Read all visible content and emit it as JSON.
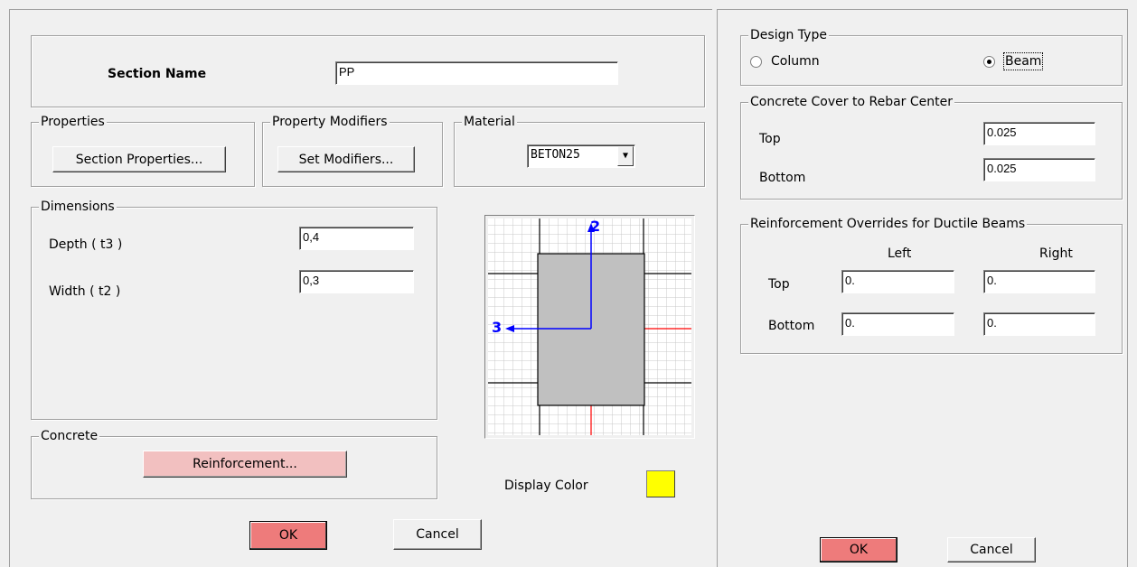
{
  "section": {
    "name_label": "Section Name",
    "name_value": "PP"
  },
  "properties": {
    "title": "Properties",
    "button": "Section Properties..."
  },
  "modifiers": {
    "title": "Property Modifiers",
    "button": "Set Modifiers..."
  },
  "material": {
    "title": "Material",
    "selected": "BETON25"
  },
  "dimensions": {
    "title": "Dimensions",
    "depth_label": "Depth ( t3 )",
    "depth_value": "0,4",
    "width_label": "Width ( t2 )",
    "width_value": "0,3"
  },
  "preview": {
    "axis_vertical": "2",
    "axis_horizontal": "3"
  },
  "concrete": {
    "title": "Concrete",
    "button": "Reinforcement..."
  },
  "display_color": {
    "label": "Display Color",
    "color": "#ffff00"
  },
  "left_buttons": {
    "ok": "OK",
    "cancel": "Cancel"
  },
  "design_type": {
    "title": "Design Type",
    "column_label": "Column",
    "beam_label": "Beam",
    "selected": "Beam"
  },
  "cover": {
    "title": "Concrete Cover to Rebar Center",
    "top_label": "Top",
    "top_value": "0.025",
    "bottom_label": "Bottom",
    "bottom_value": "0.025"
  },
  "overrides": {
    "title": "Reinforcement Overrides for Ductile Beams",
    "col_left": "Left",
    "col_right": "Right",
    "top_label": "Top",
    "top_left": "0.",
    "top_right": "0.",
    "bottom_label": "Bottom",
    "bottom_left": "0.",
    "bottom_right": "0."
  },
  "right_buttons": {
    "ok": "OK",
    "cancel": "Cancel"
  },
  "colors": {
    "ok_button": "#ee7b7b",
    "reinforcement_button": "#f2c0c0",
    "section_fill": "#c0c0c0",
    "axis": "#0000ff"
  }
}
